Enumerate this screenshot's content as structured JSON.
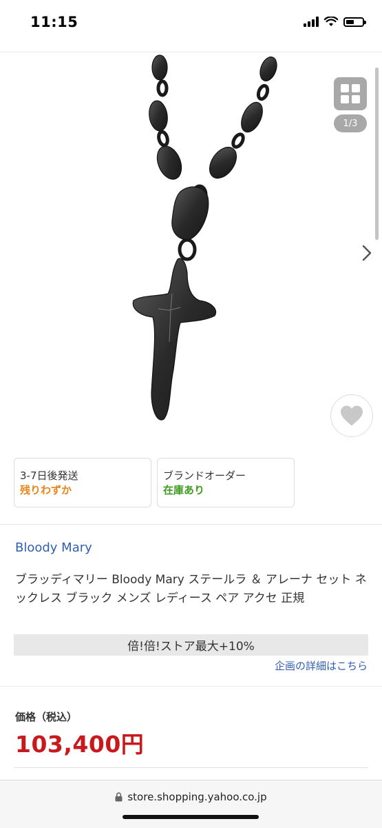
{
  "status_bar": {
    "time": "11:15"
  },
  "gallery": {
    "page_counter": "1/3"
  },
  "shipping_box": {
    "line1": "3-7日後発送",
    "line2": "残りわずか",
    "line2_color": "#e7861a"
  },
  "order_box": {
    "line1": "ブランドオーダー",
    "line2": "在庫あり",
    "line2_color": "#3e9a1e"
  },
  "product": {
    "brand": "Bloody Mary",
    "title": "ブラッディマリー Bloody Mary ステールラ ＆ アレーナ セット ネックレス ブラック メンズ レディース ペア アクセ 正規"
  },
  "promo": {
    "banner": "倍!倍!ストア最大+10%",
    "link": "企画の詳細はこちら"
  },
  "price": {
    "label": "価格（税込）",
    "value": "103,400円",
    "color": "#c8191d"
  },
  "browser": {
    "url": "store.shopping.yahoo.co.jp"
  }
}
